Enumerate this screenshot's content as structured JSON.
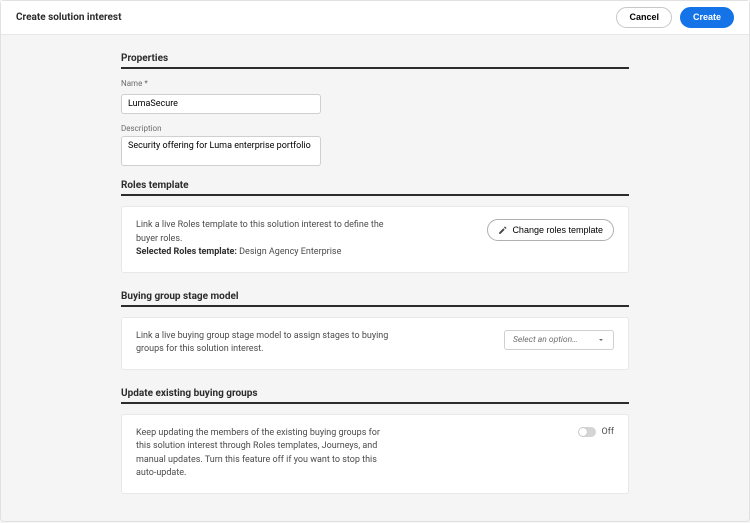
{
  "header": {
    "title": "Create solution interest",
    "cancel": "Cancel",
    "create": "Create"
  },
  "properties": {
    "heading": "Properties",
    "name_label": "Name",
    "name_value": "LumaSecure",
    "desc_label": "Description",
    "desc_value": "Security offering for Luma enterprise portfolio"
  },
  "roles": {
    "heading": "Roles template",
    "text": "Link a live Roles template to this solution interest to define the buyer roles.",
    "selected_label": "Selected Roles template:",
    "selected_value": "Design Agency Enterprise",
    "button": "Change roles template"
  },
  "stage": {
    "heading": "Buying group stage model",
    "text": "Link a live buying group stage model to assign stages to buying groups for this solution interest.",
    "placeholder": "Select an option…"
  },
  "update": {
    "heading": "Update existing buying groups",
    "text": "Keep updating the members of the existing buying groups for this solution interest through Roles templates, Journeys, and manual updates. Turn this feature off if you want to stop this auto-update.",
    "state": "Off"
  }
}
